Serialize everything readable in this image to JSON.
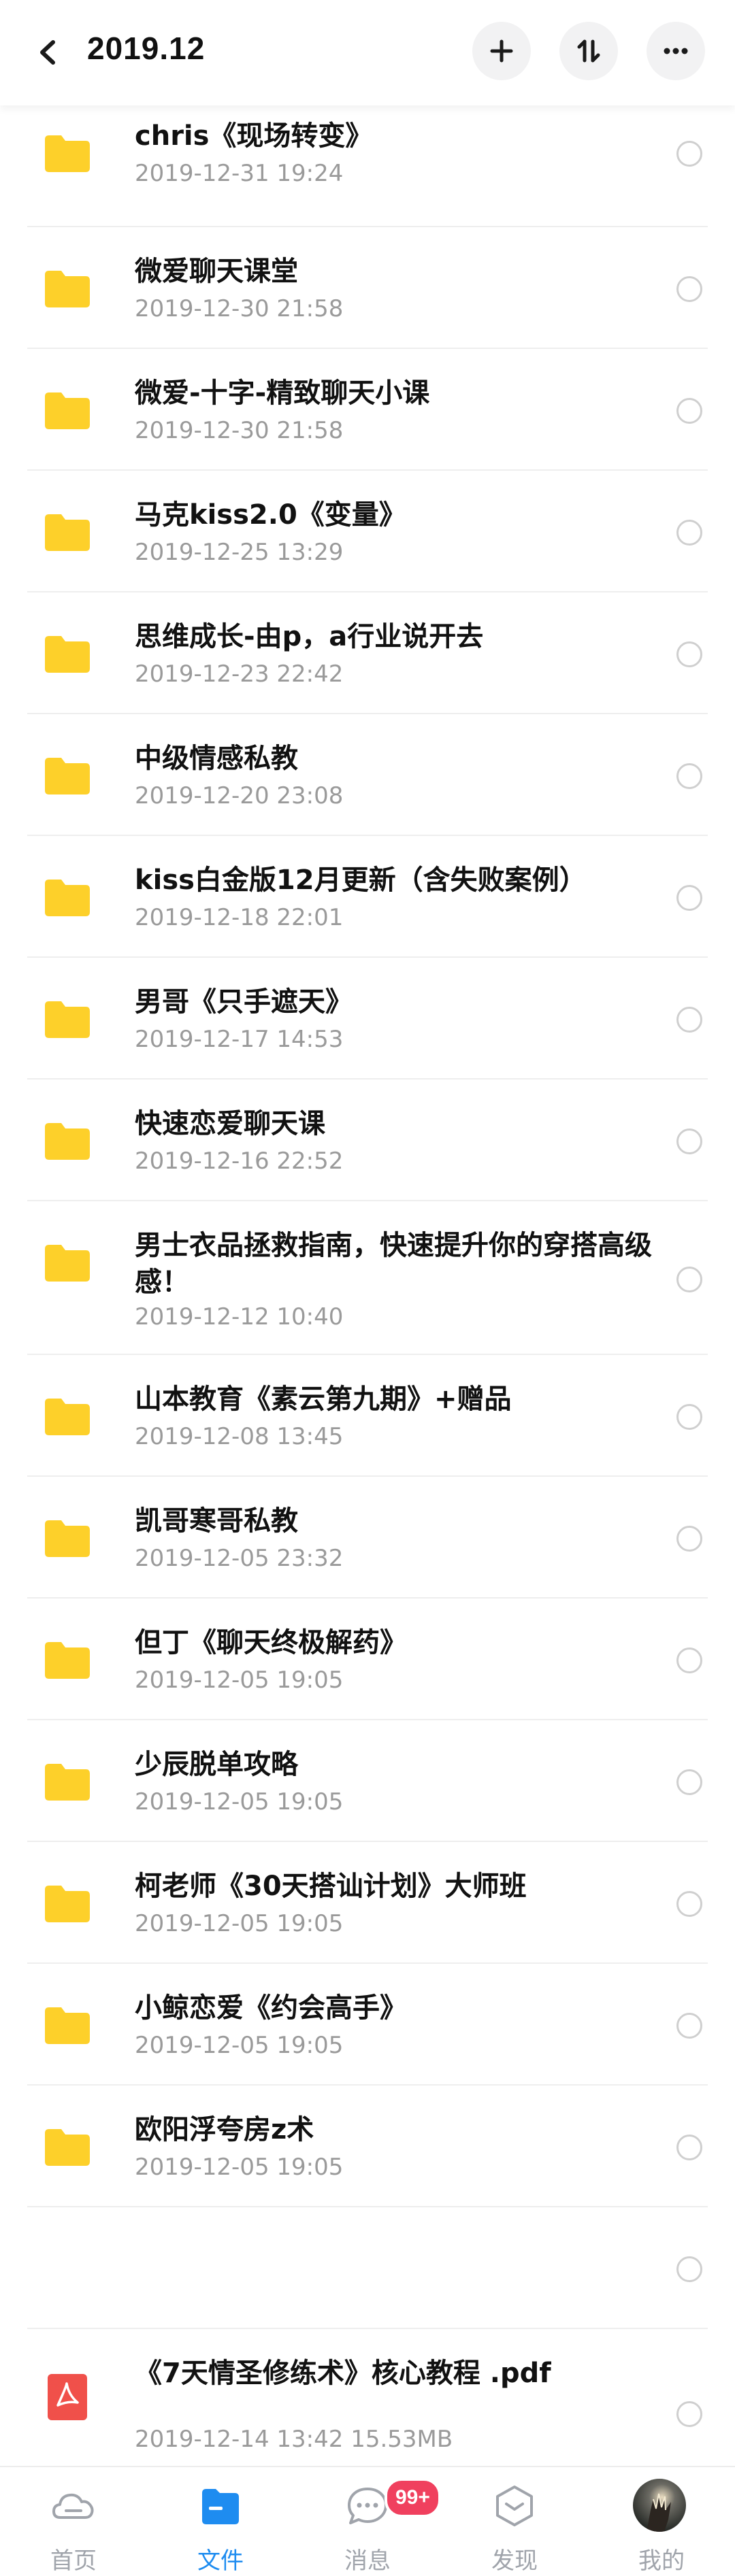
{
  "header": {
    "title": "2019.12"
  },
  "folders": [
    {
      "name": "chris《现场转变》",
      "date": "2019-12-31  19:24"
    },
    {
      "name": "微爱聊天课堂",
      "date": "2019-12-30  21:58"
    },
    {
      "name": "微爱-十字-精致聊天小课",
      "date": "2019-12-30  21:58"
    },
    {
      "name": "马克kiss2.0《变量》",
      "date": "2019-12-25  13:29"
    },
    {
      "name": "思维成长-由p，a行业说开去",
      "date": "2019-12-23  22:42"
    },
    {
      "name": "中级情感私教",
      "date": "2019-12-20  23:08"
    },
    {
      "name": "kiss白金版12月更新（含失败案例）",
      "date": "2019-12-18  22:01"
    },
    {
      "name": "男哥《只手遮天》",
      "date": "2019-12-17  14:53"
    },
    {
      "name": "快速恋爱聊天课",
      "date": "2019-12-16  22:52"
    },
    {
      "name": "男士衣品拯救指南，快速提升你的穿搭高级感！",
      "date": "2019-12-12  10:40"
    },
    {
      "name": "山本教育《素云第九期》+赠品",
      "date": "2019-12-08  13:45"
    },
    {
      "name": "凯哥寒哥私教",
      "date": "2019-12-05  23:32"
    },
    {
      "name": "但丁《聊天终极解药》",
      "date": "2019-12-05  19:05"
    },
    {
      "name": "少辰脱单攻略",
      "date": "2019-12-05  19:05"
    },
    {
      "name": "柯老师《30天搭讪计划》大师班",
      "date": "2019-12-05  19:05"
    },
    {
      "name": "小鲸恋爱《约会高手》",
      "date": "2019-12-05  19:05"
    },
    {
      "name": "欧阳浮夸房z术",
      "date": "2019-12-05  19:05"
    }
  ],
  "file": {
    "name": "《7天情圣修练术》核心教程 .pdf",
    "meta": "2019-12-14  13:42  15.53MB"
  },
  "tabs": [
    {
      "label": "首页",
      "icon": "cloud-home-icon"
    },
    {
      "label": "文件",
      "icon": "folder-tab-icon"
    },
    {
      "label": "消息",
      "icon": "message-bubble-icon"
    },
    {
      "label": "发现",
      "icon": "discover-hexagon-icon"
    },
    {
      "label": "我的",
      "icon": "avatar"
    }
  ],
  "badge": "99+",
  "colors": {
    "accent": "#1e8cf0",
    "folder": "#fdd02a",
    "badge": "#f0405e",
    "pdf": "#f0504a"
  }
}
